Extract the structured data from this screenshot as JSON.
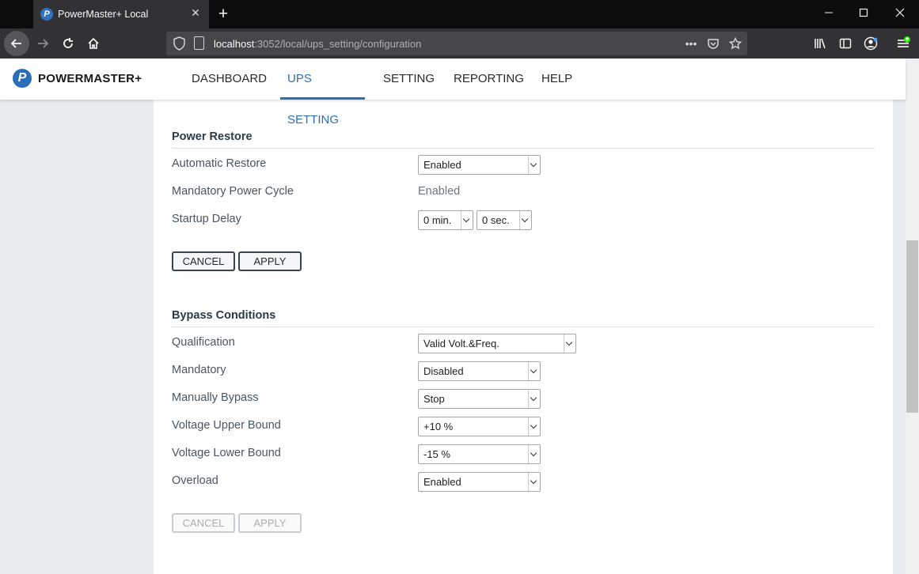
{
  "browser": {
    "tab_title": "PowerMaster+ Local",
    "url_host": "localhost",
    "url_path": ":3052/local/ups_setting/configuration"
  },
  "app": {
    "logo_text": "POWERMASTER+",
    "menu": {
      "dashboard": "DASHBOARD",
      "ups_setting": "UPS SETTING",
      "setting": "SETTING",
      "reporting": "REPORTING",
      "help": "HELP"
    },
    "active_menu": "UPS SETTING",
    "accent_color": "#2d6fb7"
  },
  "power_restore": {
    "title": "Power Restore",
    "automatic_restore": {
      "label": "Automatic Restore",
      "value": "Enabled"
    },
    "mandatory_power_cycle": {
      "label": "Mandatory Power Cycle",
      "value": "Enabled"
    },
    "startup_delay": {
      "label": "Startup Delay",
      "minutes": "0 min.",
      "seconds": "0 sec."
    },
    "cancel_label": "CANCEL",
    "apply_label": "APPLY"
  },
  "bypass_conditions": {
    "title": "Bypass Conditions",
    "qualification": {
      "label": "Qualification",
      "value": "Valid Volt.&Freq."
    },
    "mandatory": {
      "label": "Mandatory",
      "value": "Disabled"
    },
    "manually_bypass": {
      "label": "Manually Bypass",
      "value": "Stop"
    },
    "voltage_upper_bound": {
      "label": "Voltage Upper Bound",
      "value": "+10 %"
    },
    "voltage_lower_bound": {
      "label": "Voltage Lower Bound",
      "value": "-15 %"
    },
    "overload": {
      "label": "Overload",
      "value": "Enabled"
    },
    "cancel_label": "CANCEL",
    "apply_label": "APPLY",
    "buttons_disabled": true
  }
}
